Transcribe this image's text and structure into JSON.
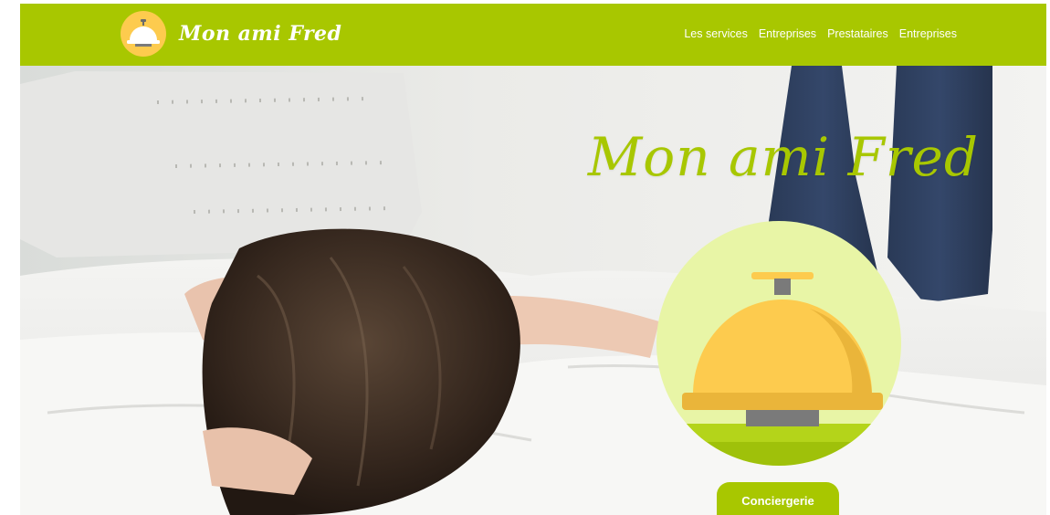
{
  "brand": {
    "name": "Mon ami Fred",
    "logo_icon": "service-bell-icon"
  },
  "nav": {
    "items": [
      {
        "label": "Les services"
      },
      {
        "label": "Entreprises"
      },
      {
        "label": "Prestataires"
      },
      {
        "label": "Entreprises"
      }
    ]
  },
  "hero": {
    "title": "Mon ami Fred",
    "icon": "service-bell-icon",
    "cta_label": "Conciergerie"
  },
  "colors": {
    "accent": "#a8c700",
    "white": "#ffffff",
    "bell_gold": "#fdcb4e",
    "bell_shadow": "#eab53a",
    "badge_bg": "#e8f5a6",
    "badge_ground": "#9fc10a",
    "bell_base": "#7a7a7a"
  }
}
